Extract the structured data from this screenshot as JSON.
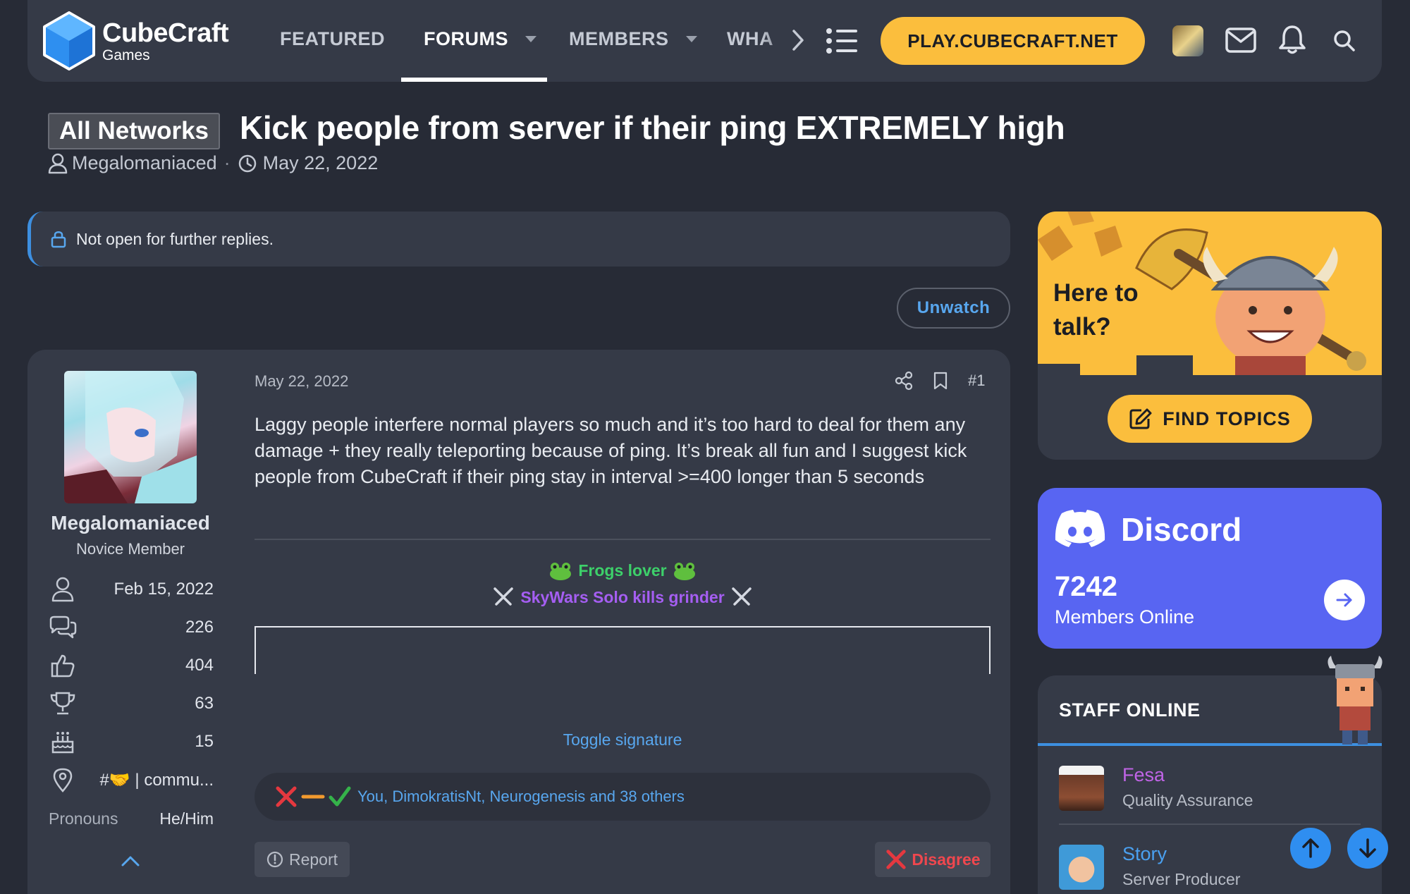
{
  "brand": {
    "name": "CubeCraft",
    "sub": "Games"
  },
  "nav": {
    "items": [
      {
        "label": "FEATURED"
      },
      {
        "label": "FORUMS"
      },
      {
        "label": "MEMBERS"
      },
      {
        "label": "WHA"
      }
    ],
    "play_label": "PLAY.CUBECRAFT.NET"
  },
  "thread": {
    "prefix": "All Networks",
    "title": "Kick people from server if their ping EXTREMELY high",
    "author": "Megalomaniaced",
    "date": "May 22, 2022",
    "locked_notice": "Not open for further replies.",
    "unwatch_label": "Unwatch"
  },
  "post": {
    "date": "May 22, 2022",
    "number": "#1",
    "body": "Laggy people interfere normal players so much and it’s too hard to deal for them any damage + they really teleporting because of ping. It’s break all fun and I suggest kick people from CubeCraft if their ping stay in interval >=400 longer than 5 seconds",
    "signature_line1": "Frogs lover",
    "signature_line2": "SkyWars Solo kills grinder",
    "toggle_signature": "Toggle signature",
    "reactions_text": "You, DimokratisNt, Neurogenesis and 38 others",
    "report_label": "Report",
    "disagree_label": "Disagree"
  },
  "user": {
    "name": "Megalomaniaced",
    "title": "Novice Member",
    "joined": "Feb 15, 2022",
    "messages": "226",
    "reactions": "404",
    "points": "63",
    "age": "15",
    "location": "#🤝 | commu...",
    "pronouns_label": "Pronouns",
    "pronouns_value": "He/Him"
  },
  "sidebar": {
    "promo_line1": "Here to",
    "promo_line2": "talk?",
    "find_topics": "FIND TOPICS",
    "discord_title": "Discord",
    "discord_count": "7242",
    "discord_label": "Members Online",
    "staff_header": "STAFF ONLINE",
    "staff": [
      {
        "name": "Fesa",
        "role": "Quality Assurance",
        "color": "#c064e6"
      },
      {
        "name": "Story",
        "role": "Server Producer",
        "color": "#4aa0f0"
      }
    ]
  },
  "colors": {
    "accent_blue": "#3d8fe0",
    "link_blue": "#58a7ef",
    "brand_yellow": "#fbbe3d",
    "discord": "#5865f2"
  }
}
